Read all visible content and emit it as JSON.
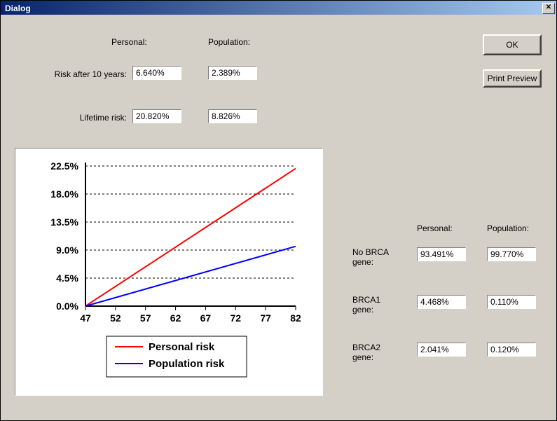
{
  "title": "Dialog",
  "buttons": {
    "ok": "OK",
    "print_preview": "Print Preview"
  },
  "headers": {
    "personal": "Personal:",
    "population": "Population:"
  },
  "rows": {
    "risk10": {
      "label": "Risk after 10 years:",
      "personal": "6.640%",
      "population": "2.389%"
    },
    "lifetime": {
      "label": "Lifetime risk:",
      "personal": "20.820%",
      "population": "8.826%"
    }
  },
  "gene_headers": {
    "personal": "Personal:",
    "population": "Population:"
  },
  "genes": {
    "nobrca": {
      "label": "No BRCA gene:",
      "personal": "93.491%",
      "population": "99.770%"
    },
    "brca1": {
      "label": "BRCA1 gene:",
      "personal": "4.468%",
      "population": "0.110%"
    },
    "brca2": {
      "label": "BRCA2 gene:",
      "personal": "2.041%",
      "population": "0.120%"
    }
  },
  "chart_data": {
    "type": "line",
    "xlabel": "",
    "ylabel": "",
    "x_ticks": [
      47,
      52,
      57,
      62,
      67,
      72,
      77,
      82
    ],
    "y_ticks": [
      0.0,
      4.5,
      9.0,
      13.5,
      18.0,
      22.5
    ],
    "y_tick_labels": [
      "0.0%",
      "4.5%",
      "9.0%",
      "13.5%",
      "18.0%",
      "22.5%"
    ],
    "xlim": [
      47,
      82
    ],
    "ylim": [
      0,
      22.5
    ],
    "series": [
      {
        "name": "Personal risk",
        "color": "#ff0000",
        "x": [
          47,
          82
        ],
        "y": [
          0.0,
          22.1
        ]
      },
      {
        "name": "Population risk",
        "color": "#0000ff",
        "x": [
          47,
          82
        ],
        "y": [
          0.0,
          9.6
        ]
      }
    ],
    "legend": [
      "Personal risk",
      "Population risk"
    ]
  }
}
